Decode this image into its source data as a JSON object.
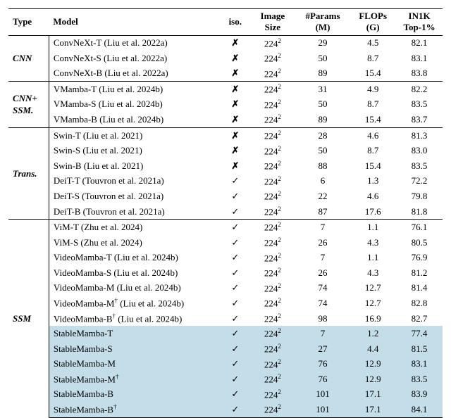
{
  "columns": {
    "type": "Type",
    "model": "Model",
    "iso": "iso.",
    "image_size": "Image\nSize",
    "params": "#Params\n(M)",
    "flops": "FLOPs\n(G)",
    "top1": "IN1K\nTop-1%"
  },
  "groups": [
    {
      "type": "CNN",
      "rows": [
        {
          "model": "ConvNeXt-T (Liu et al. 2022a)",
          "iso": "✗",
          "img": "224²",
          "params": "29",
          "flops": "4.5",
          "top1": "82.1"
        },
        {
          "model": "ConvNeXt-S (Liu et al. 2022a)",
          "iso": "✗",
          "img": "224²",
          "params": "50",
          "flops": "8.7",
          "top1": "83.1"
        },
        {
          "model": "ConvNeXt-B (Liu et al. 2022a)",
          "iso": "✗",
          "img": "224²",
          "params": "89",
          "flops": "15.4",
          "top1": "83.8"
        }
      ]
    },
    {
      "type": "CNN+\nSSM.",
      "rows": [
        {
          "model": "VMamba-T (Liu et al. 2024b)",
          "iso": "✗",
          "img": "224²",
          "params": "31",
          "flops": "4.9",
          "top1": "82.2"
        },
        {
          "model": "VMamba-S (Liu et al. 2024b)",
          "iso": "✗",
          "img": "224²",
          "params": "50",
          "flops": "8.7",
          "top1": "83.5"
        },
        {
          "model": "VMamba-B (Liu et al. 2024b)",
          "iso": "✗",
          "img": "224²",
          "params": "89",
          "flops": "15.4",
          "top1": "83.7"
        }
      ]
    },
    {
      "type": "Trans.",
      "rows": [
        {
          "model": "Swin-T (Liu et al. 2021)",
          "iso": "✗",
          "img": "224²",
          "params": "28",
          "flops": "4.6",
          "top1": "81.3"
        },
        {
          "model": "Swin-S (Liu et al. 2021)",
          "iso": "✗",
          "img": "224²",
          "params": "50",
          "flops": "8.7",
          "top1": "83.0"
        },
        {
          "model": "Swin-B (Liu et al. 2021)",
          "iso": "✗",
          "img": "224²",
          "params": "88",
          "flops": "15.4",
          "top1": "83.5"
        },
        {
          "model": "DeiT-T (Touvron et al. 2021a)",
          "iso": "✓",
          "img": "224²",
          "params": "6",
          "flops": "1.3",
          "top1": "72.2"
        },
        {
          "model": "DeiT-S (Touvron et al. 2021a)",
          "iso": "✓",
          "img": "224²",
          "params": "22",
          "flops": "4.6",
          "top1": "79.8"
        },
        {
          "model": "DeiT-B (Touvron et al. 2021a)",
          "iso": "✓",
          "img": "224²",
          "params": "87",
          "flops": "17.6",
          "top1": "81.8"
        }
      ]
    },
    {
      "type": "SSM",
      "rows": [
        {
          "model": "ViM-T (Zhu et al. 2024)",
          "iso": "✓",
          "img": "224²",
          "params": "7",
          "flops": "1.1",
          "top1": "76.1"
        },
        {
          "model": "ViM-S (Zhu et al. 2024)",
          "iso": "✓",
          "img": "224²",
          "params": "26",
          "flops": "4.3",
          "top1": "80.5"
        },
        {
          "model": "VideoMamba-T (Liu et al. 2024b)",
          "iso": "✓",
          "img": "224²",
          "params": "7",
          "flops": "1.1",
          "top1": "76.9"
        },
        {
          "model": "VideoMamba-S (Liu et al. 2024b)",
          "iso": "✓",
          "img": "224²",
          "params": "26",
          "flops": "4.3",
          "top1": "81.2"
        },
        {
          "model": "VideoMamba-M (Liu et al. 2024b)",
          "iso": "✓",
          "img": "224²",
          "params": "74",
          "flops": "12.7",
          "top1": "81.4"
        },
        {
          "model": "VideoMamba-M† (Liu et al. 2024b)",
          "dagger": true,
          "iso": "✓",
          "img": "224²",
          "params": "74",
          "flops": "12.7",
          "top1": "82.8"
        },
        {
          "model": "VideoMamba-B† (Liu et al. 2024b)",
          "dagger": true,
          "iso": "✓",
          "img": "224²",
          "params": "98",
          "flops": "16.9",
          "top1": "82.7"
        },
        {
          "model": "StableMamba-T",
          "iso": "✓",
          "img": "224²",
          "params": "7",
          "flops": "1.2",
          "top1": "77.4",
          "hl": true
        },
        {
          "model": "StableMamba-S",
          "iso": "✓",
          "img": "224²",
          "params": "27",
          "flops": "4.4",
          "top1": "81.5",
          "hl": true
        },
        {
          "model": "StableMamba-M",
          "iso": "✓",
          "img": "224²",
          "params": "76",
          "flops": "12.9",
          "top1": "83.1",
          "hl": true
        },
        {
          "model": "StableMamba-M†",
          "dagger": true,
          "iso": "✓",
          "img": "224²",
          "params": "76",
          "flops": "12.9",
          "top1": "83.5",
          "hl": true
        },
        {
          "model": "StableMamba-B",
          "iso": "✓",
          "img": "224²",
          "params": "101",
          "flops": "17.1",
          "top1": "83.9",
          "hl": true
        },
        {
          "model": "StableMamba-B†",
          "dagger": true,
          "iso": "✓",
          "img": "224²",
          "params": "101",
          "flops": "17.1",
          "top1": "84.1",
          "hl": true
        }
      ]
    }
  ]
}
